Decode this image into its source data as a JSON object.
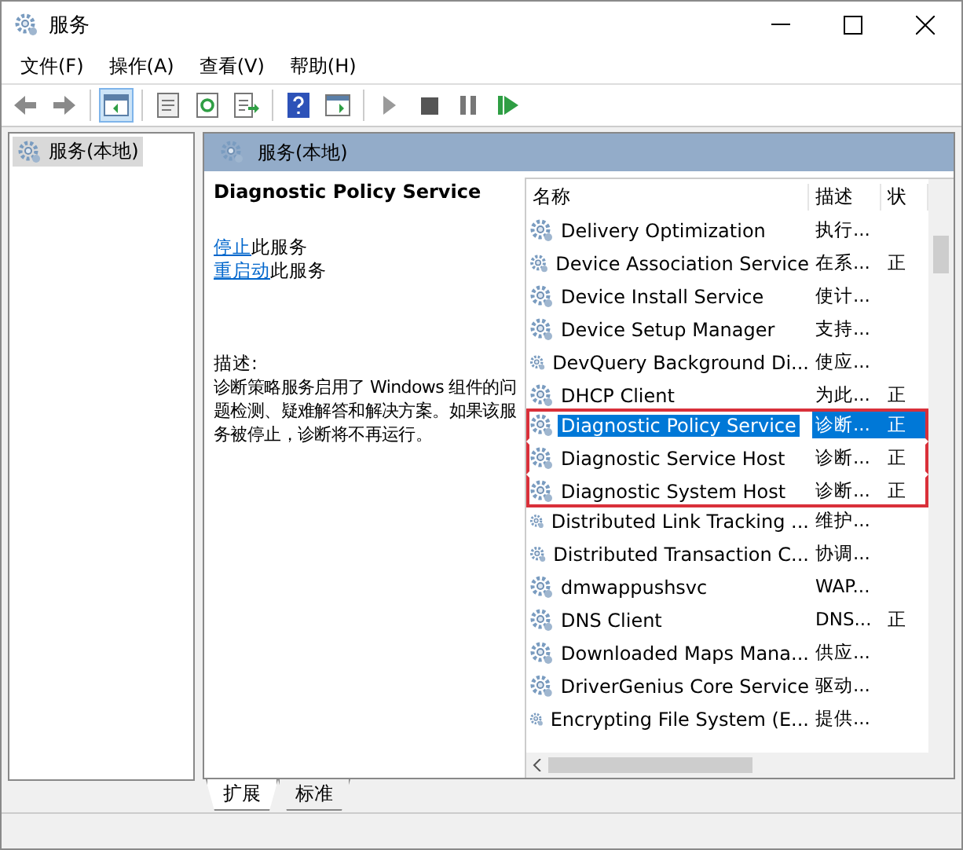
{
  "window": {
    "title": "服务"
  },
  "menu": [
    "文件(F)",
    "操作(A)",
    "查看(V)",
    "帮助(H)"
  ],
  "toolbar": [
    {
      "kind": "back",
      "selected": false
    },
    {
      "kind": "forward",
      "selected": false
    },
    {
      "kind": "sep"
    },
    {
      "kind": "tree",
      "selected": true
    },
    {
      "kind": "sep"
    },
    {
      "kind": "properties",
      "selected": false
    },
    {
      "kind": "refresh",
      "selected": false
    },
    {
      "kind": "export",
      "selected": false
    },
    {
      "kind": "sep"
    },
    {
      "kind": "help",
      "selected": false
    },
    {
      "kind": "view",
      "selected": false
    },
    {
      "kind": "sep"
    },
    {
      "kind": "play",
      "selected": false
    },
    {
      "kind": "stop",
      "selected": false
    },
    {
      "kind": "pause",
      "selected": false
    },
    {
      "kind": "restart",
      "selected": false
    }
  ],
  "tree": [
    {
      "label": "服务(本地)",
      "selected": true
    }
  ],
  "panel_header": "服务(本地)",
  "details": {
    "title": "Diagnostic Policy Service",
    "actions": [
      {
        "link": "停止",
        "rest": "此服务"
      },
      {
        "link": "重启动",
        "rest": "此服务"
      }
    ],
    "description_label": "描述:",
    "description": "诊断策略服务启用了 Windows 组件的问题检测、疑难解答和解决方案。如果该服务被停止，诊断将不再运行。"
  },
  "table": {
    "columns": [
      "名称",
      "描述",
      "状"
    ],
    "rows": [
      {
        "name": "Delivery Optimization",
        "description": "执行...",
        "status": "",
        "selected": false,
        "outlined": false
      },
      {
        "name": "Device Association Service",
        "description": "在系...",
        "status": "正",
        "selected": false,
        "outlined": false
      },
      {
        "name": "Device Install Service",
        "description": "使计...",
        "status": "",
        "selected": false,
        "outlined": false
      },
      {
        "name": "Device Setup Manager",
        "description": "支持...",
        "status": "",
        "selected": false,
        "outlined": false
      },
      {
        "name": "DevQuery Background Di...",
        "description": "使应...",
        "status": "",
        "selected": false,
        "outlined": false
      },
      {
        "name": "DHCP Client",
        "description": "为此...",
        "status": "正",
        "selected": false,
        "outlined": false
      },
      {
        "name": "Diagnostic Policy Service",
        "description": "诊断...",
        "status": "正",
        "selected": true,
        "outlined": true
      },
      {
        "name": "Diagnostic Service Host",
        "description": "诊断...",
        "status": "正",
        "selected": false,
        "outlined": true
      },
      {
        "name": "Diagnostic System Host",
        "description": "诊断...",
        "status": "正",
        "selected": false,
        "outlined": true
      },
      {
        "name": "Distributed Link Tracking ...",
        "description": "维护...",
        "status": "",
        "selected": false,
        "outlined": false
      },
      {
        "name": "Distributed Transaction C...",
        "description": "协调...",
        "status": "",
        "selected": false,
        "outlined": false
      },
      {
        "name": "dmwappushsvc",
        "description": "WAP...",
        "status": "",
        "selected": false,
        "outlined": false
      },
      {
        "name": "DNS Client",
        "description": "DNS...",
        "status": "正",
        "selected": false,
        "outlined": false
      },
      {
        "name": "Downloaded Maps Mana...",
        "description": "供应...",
        "status": "",
        "selected": false,
        "outlined": false
      },
      {
        "name": "DriverGenius Core Service",
        "description": "驱动...",
        "status": "",
        "selected": false,
        "outlined": false
      },
      {
        "name": "Encrypting File System (E...",
        "description": "提供...",
        "status": "",
        "selected": false,
        "outlined": false
      }
    ]
  },
  "tabs": [
    {
      "label": "扩展",
      "selected": true
    },
    {
      "label": "标准",
      "selected": false
    }
  ]
}
